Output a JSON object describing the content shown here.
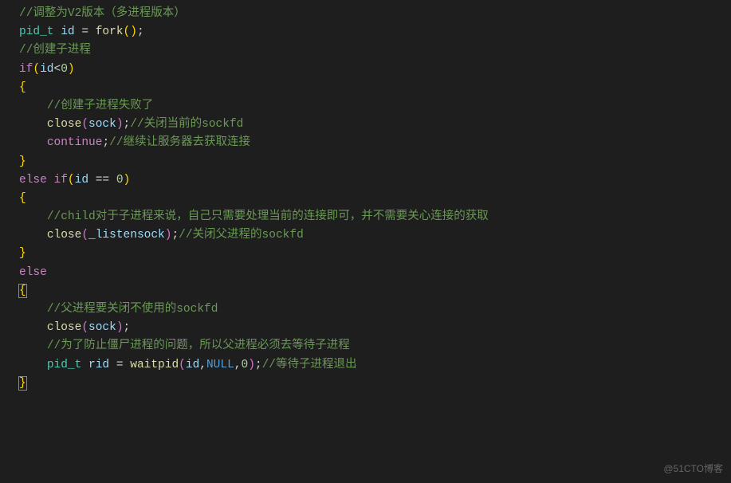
{
  "code": {
    "line1_comment": "//调整为V2版本（多进程版本）",
    "line2_type": "pid_t",
    "line2_var": " id ",
    "line2_eq": "= ",
    "line2_func": "fork",
    "line2_parens": "()",
    "line2_semi": ";",
    "line3_comment": "//创建子进程",
    "line4_if": "if",
    "line4_var": "id",
    "line4_op": "<",
    "line4_num": "0",
    "line5_brace": "{",
    "line6_comment": "//创建子进程失败了",
    "line7_func": "close",
    "line7_var": "sock",
    "line7_semi": ";",
    "line7_comment": "//关闭当前的sockfd",
    "line8_keyword": "continue",
    "line8_semi": ";",
    "line8_comment": "//继续让服务器去获取连接",
    "line9_brace": "}",
    "line10_else": "else",
    "line10_if": " if",
    "line10_var": "id ",
    "line10_eq": "== ",
    "line10_num": "0",
    "line11_brace": "{",
    "line12_comment": "//child对于子进程来说，自己只需要处理当前的连接即可，并不需要关心连接的获取",
    "line13_func": "close",
    "line13_var": "_listensock",
    "line13_semi": ";",
    "line13_comment": "//关闭父进程的sockfd",
    "line14_brace": "}",
    "line15_else": "else",
    "line16_brace": "{",
    "line17_comment": "//父进程要关闭不使用的sockfd",
    "line18_func": "close",
    "line18_var": "sock",
    "line18_semi": ";",
    "line19_comment": "//为了防止僵尸进程的问题，所以父进程必须去等待子进程",
    "line20_type": "pid_t",
    "line20_var": " rid ",
    "line20_eq": "= ",
    "line20_func": "waitpid",
    "line20_arg1": "id",
    "line20_comma1": ",",
    "line20_null": "NULL",
    "line20_comma2": ",",
    "line20_num": "0",
    "line20_semi": ";",
    "line20_comment": "//等待子进程退出",
    "line21_brace": "}"
  },
  "watermark": "@51CTO博客"
}
